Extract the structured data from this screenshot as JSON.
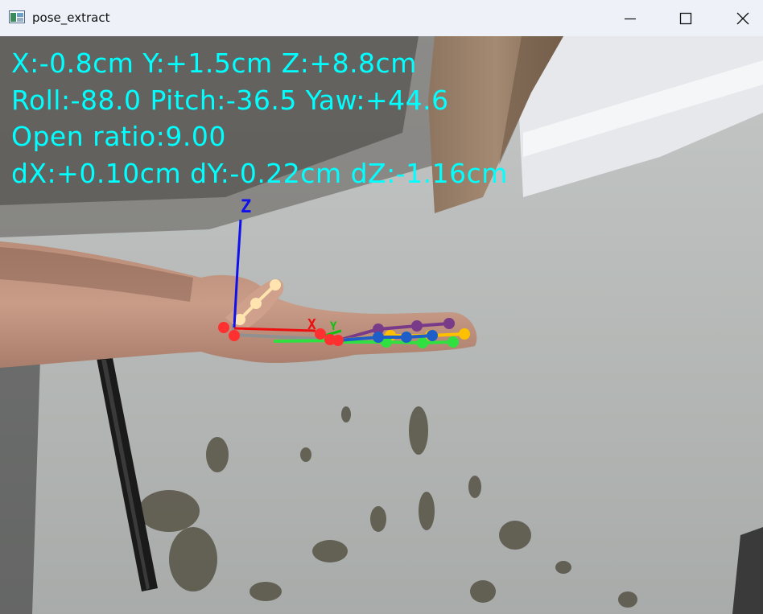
{
  "window": {
    "title": "pose_extract",
    "controls": {
      "minimize": "minimize-icon",
      "maximize": "maximize-icon",
      "close": "close-icon"
    }
  },
  "overlay": {
    "color": "#00ffff",
    "line1": "X:-0.8cm Y:+1.5cm Z:+8.8cm",
    "line2": "Roll:-88.0 Pitch:-36.5 Yaw:+44.6",
    "line3": "Open ratio:9.00",
    "line4": "dX:+0.10cm dY:-0.22cm dZ:-1.16cm"
  },
  "axes": {
    "z": {
      "label": "Z",
      "color": "#1010ee"
    },
    "x": {
      "label": "X",
      "color": "#ee1010"
    },
    "y": {
      "label": "Y",
      "color": "#10c010"
    }
  },
  "landmark_colors": {
    "wrist": "#ff3030",
    "thumb": "#ffe4b0",
    "index": "#7a3a8a",
    "middle": "#ffc000",
    "ring": "#1e5ec8",
    "pinky": "#30e040",
    "palm": "#909090"
  }
}
